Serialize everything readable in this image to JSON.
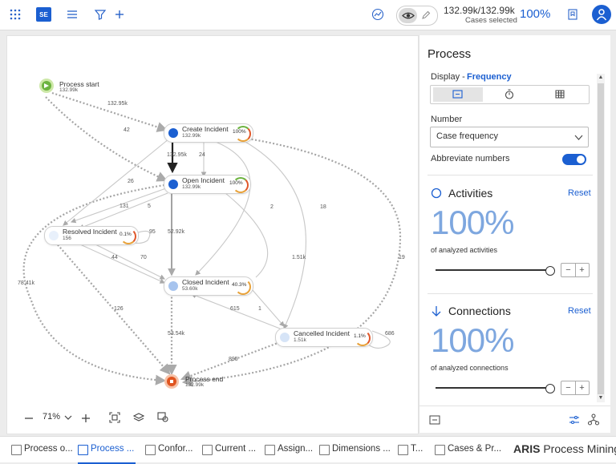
{
  "toolbar": {
    "apps_icon": "grid-dots-icon",
    "project_badge": "SE",
    "menu_icon": "hamburger-icon",
    "filter_icon": "filter-icon",
    "add_icon": "plus-icon",
    "chart_icon": "trend-icon",
    "cases_selected_value": "132.99k/132.99k",
    "cases_selected_label": "Cases selected",
    "cases_selected_percent": "100%",
    "bookmark_icon": "bookmark-icon",
    "user_icon": "user-icon",
    "accent_color": "#1b5fd1"
  },
  "process_map": {
    "nodes": {
      "start": {
        "name": "Process start",
        "count": "132.99k"
      },
      "create": {
        "name": "Create Incident",
        "count": "132.99k",
        "percent": "100%"
      },
      "open": {
        "name": "Open Incident",
        "count": "132.99k",
        "percent": "100%"
      },
      "resolved": {
        "name": "Resolved Incident",
        "count": "156",
        "percent": "0.1%"
      },
      "closed": {
        "name": "Closed Incident",
        "count": "53.60k",
        "percent": "40.3%"
      },
      "cancelled": {
        "name": "Cancelled Incident",
        "count": "1.51k",
        "percent": "1.1%"
      },
      "end": {
        "name": "Process end",
        "count": "132.99k"
      }
    },
    "edge_labels": {
      "start_create": "132.95k",
      "start_open": "42",
      "create_open": "132.95k",
      "open_create": "24",
      "e26": "26",
      "e131": "131",
      "e5": "5",
      "e95": "95",
      "open_closed": "52.92k",
      "e2": "2",
      "e18": "18",
      "e44": "44",
      "e70": "70",
      "e151k": "1.51k",
      "e78k": "78.41k",
      "e126": "126",
      "e615": "615",
      "e1": "1",
      "e19": "19",
      "closed_end": "53.54k",
      "e686": "686",
      "cancelled_end": "895"
    },
    "zoom": "71%"
  },
  "panel": {
    "title": "Process",
    "display_label": "Display - ",
    "display_mode": "Frequency",
    "number_label": "Number",
    "number_value": "Case frequency",
    "abbreviate_label": "Abbreviate numbers",
    "abbreviate_on": true,
    "activities": {
      "title": "Activities",
      "reset": "Reset",
      "percent": "100%",
      "caption": "of analyzed activities",
      "slider_level": 1.0
    },
    "connections": {
      "title": "Connections",
      "reset": "Reset",
      "percent": "100%",
      "caption": "of analyzed connections",
      "slider_level": 1.0
    }
  },
  "tabs": [
    {
      "label": "Process o...",
      "icon": "chart-icon",
      "active": false
    },
    {
      "label": "Process ...",
      "icon": "process-icon",
      "active": true
    },
    {
      "label": "Confor...",
      "icon": "check-icon",
      "active": false
    },
    {
      "label": "Current ...",
      "icon": "grid-icon",
      "active": false
    },
    {
      "label": "Assign...",
      "icon": "grid-icon",
      "active": false
    },
    {
      "label": "Dimensions ...",
      "icon": "grid-icon",
      "active": false
    },
    {
      "label": "T...",
      "icon": "grid-icon",
      "active": false
    },
    {
      "label": "Cases & Pr...",
      "icon": "grid-icon",
      "active": false
    }
  ],
  "brand": {
    "bold": "ARIS",
    "rest": " Process Mining"
  }
}
